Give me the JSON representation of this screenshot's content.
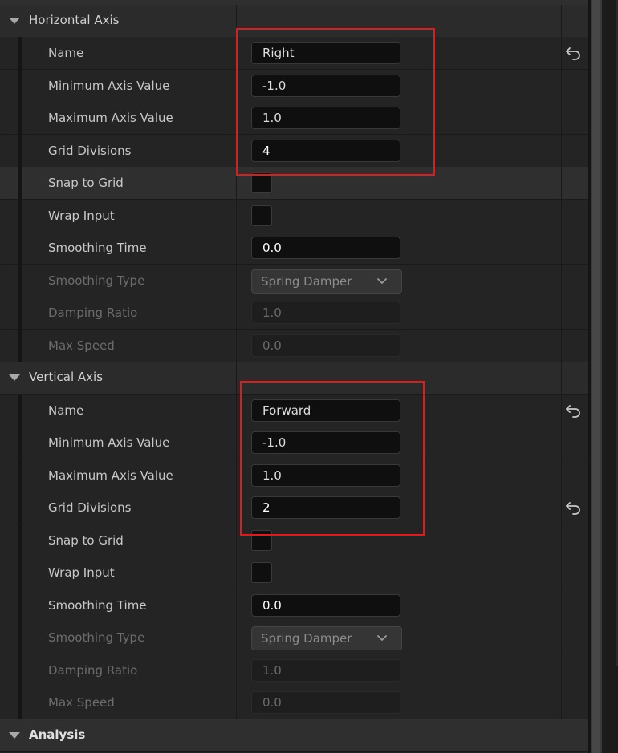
{
  "sections": {
    "horizontal": {
      "title": "Horizontal Axis",
      "name_label": "Name",
      "name_value": "Right",
      "min_label": "Minimum Axis Value",
      "min_value": "-1.0",
      "max_label": "Maximum Axis Value",
      "max_value": "1.0",
      "grid_label": "Grid Divisions",
      "grid_value": "4",
      "snap_label": "Snap to Grid",
      "wrap_label": "Wrap Input",
      "smooth_time_label": "Smoothing Time",
      "smooth_time_value": "0.0",
      "smooth_type_label": "Smoothing Type",
      "smooth_type_value": "Spring Damper",
      "damping_label": "Damping Ratio",
      "damping_value": "1.0",
      "max_speed_label": "Max Speed",
      "max_speed_value": "0.0"
    },
    "vertical": {
      "title": "Vertical Axis",
      "name_label": "Name",
      "name_value": "Forward",
      "min_label": "Minimum Axis Value",
      "min_value": "-1.0",
      "max_label": "Maximum Axis Value",
      "max_value": "1.0",
      "grid_label": "Grid Divisions",
      "grid_value": "2",
      "snap_label": "Snap to Grid",
      "wrap_label": "Wrap Input",
      "smooth_time_label": "Smoothing Time",
      "smooth_time_value": "0.0",
      "smooth_type_label": "Smoothing Type",
      "smooth_type_value": "Spring Damper",
      "damping_label": "Damping Ratio",
      "damping_value": "1.0",
      "max_speed_label": "Max Speed",
      "max_speed_value": "0.0"
    },
    "analysis": {
      "title": "Analysis"
    }
  },
  "icons": {
    "expand": "caret-down-icon",
    "reset": "reset-to-default-icon",
    "dropdown": "chevron-down-icon"
  },
  "colors": {
    "highlight_box": "#e81818",
    "panel_bg": "#242424"
  }
}
